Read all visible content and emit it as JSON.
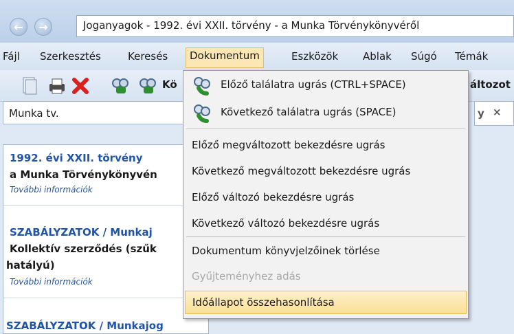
{
  "titlebar": {
    "back_icon": "arrow-left-icon",
    "forward_icon": "arrow-right-icon",
    "address": "Joganyagok - 1992. évi XXII. törvény - a Munka Törvénykönyvéről"
  },
  "menubar": {
    "items": [
      {
        "label": "Fájl"
      },
      {
        "label": "Szerkesztés"
      },
      {
        "label": "Keresés"
      },
      {
        "label": "Dokumentum"
      },
      {
        "label": "Eszközök"
      },
      {
        "label": "Ablak"
      },
      {
        "label": "Súgó"
      },
      {
        "label": "Témák"
      }
    ],
    "active": "Dokumentum"
  },
  "toolbar": {
    "text_left": "Kö",
    "text_right": "áltozot"
  },
  "search": {
    "value": "Munka tv."
  },
  "tab": {
    "close_glyph": "×",
    "partial_glyph": "y"
  },
  "leftpanel": {
    "entries": [
      {
        "title": "1992. évi XXII. törvény",
        "subtitle": "a Munka Törvénykönyvén",
        "info": "További információk"
      },
      {
        "title": "SZABÁLYZATOK / Munkaj",
        "subtitle": "Kollektív szerződés (szűk",
        "subtitle2": "hatályú)",
        "info": "További információk"
      },
      {
        "title": "SZABÁLYZATOK / Munkajog"
      }
    ]
  },
  "dropdown": {
    "items": [
      {
        "label": "Előző találatra ugrás (CTRL+SPACE)",
        "icon": "binoculars-icon"
      },
      {
        "label": "Következő találatra ugrás (SPACE)",
        "icon": "binoculars-icon"
      },
      {
        "label": "Előző megváltozott bekezdésre ugrás"
      },
      {
        "label": "Következő megváltozott bekezdésre ugrás"
      },
      {
        "label": "Előző változó bekezdésre ugrás"
      },
      {
        "label": "Következő változó bekezdésre ugrás"
      },
      {
        "label": "Dokumentum könyvjelzőinek törlése"
      },
      {
        "label": "Gyűjteményhez adás",
        "disabled": true
      },
      {
        "label": "Időállapot összehasonlítása",
        "highlighted": true
      }
    ]
  }
}
